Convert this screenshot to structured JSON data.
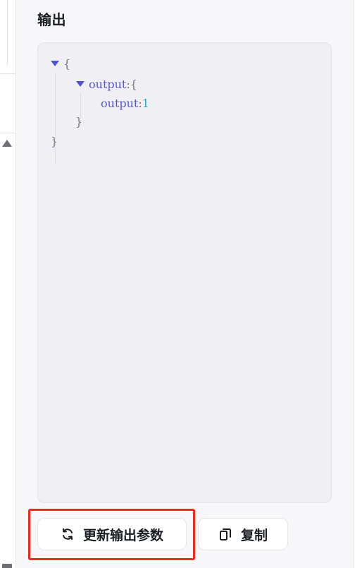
{
  "section": {
    "title": "输出"
  },
  "json_viewer": {
    "open_brace": "{",
    "close_brace": "}",
    "nested": {
      "key": "output",
      "colon": ":",
      "open_brace": "{",
      "close_brace": "}",
      "child": {
        "key": "output",
        "colon": ":",
        "value": "1"
      }
    }
  },
  "actions": {
    "refresh_label": "更新输出参数",
    "copy_label": "复制"
  },
  "colors": {
    "highlight": "#ec2a22",
    "key": "#5458cf",
    "number": "#27aeb5"
  },
  "icons": {
    "refresh": "refresh-icon",
    "copy": "copy-icon",
    "collapse": "caret-down-icon"
  }
}
